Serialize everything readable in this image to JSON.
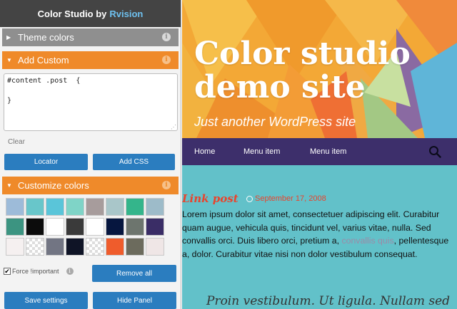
{
  "panel": {
    "header_prefix": "Color Studio by",
    "header_brand": "Rvision",
    "theme_colors_label": "Theme colors",
    "add_custom_label": "Add Custom",
    "css_editor_value": "#content .post  {\n\n}",
    "clear_label": "Clear",
    "locator_label": "Locator",
    "add_css_label": "Add CSS",
    "customize_colors_label": "Customize colors",
    "swatches": [
      "#9dbbd9",
      "#68c6ca",
      "#5ac5d9",
      "#7fd4c7",
      "#a79c9c",
      "#a9c6c9",
      "#34b58b",
      "#9dbbc9",
      "#3c9481",
      "#0c0c0c",
      "#ffffff",
      "#3a3a3a",
      "#ffffff",
      "#06163f",
      "#6d756e",
      "#3a2d66",
      "#f5f0f0",
      "checker",
      "#727583",
      "#0f1426",
      "checker",
      "#ef5c2c",
      "#6c6b5d",
      "#efe6e6"
    ],
    "force_important_label": "Force !important",
    "force_important_checked": "✔",
    "remove_all_label": "Remove all",
    "save_label": "Save settings",
    "hide_label": "Hide Panel",
    "info_glyph": "i",
    "accent_orange": "#ef8a2a",
    "accent_blue": "#2b7dbf"
  },
  "site": {
    "title": "Color studio demo site",
    "tagline": "Just another WordPress site",
    "nav": [
      "Home",
      "Menu item",
      "Menu item"
    ],
    "post_title": "Link post",
    "post_date": "September 17, 2008",
    "post_body_1": "Lorem ipsum dolor sit amet, consectetuer adipiscing elit. Curabitur quam augue, vehicula quis, tincidunt vel, varius vitae, nulla. Sed convallis orci. Duis libero orci, pretium a, ",
    "post_body_link": "convallis quis",
    "post_body_2": ", pellentesque a, dolor. Curabitur vitae nisi non dolor vestibulum consequat.",
    "quote": "Proin vestibulum. Ut ligula. Nullam sed",
    "nav_color": "#3d2f6b",
    "content_bg": "#62c1c9",
    "accent_red": "#e8442d"
  }
}
